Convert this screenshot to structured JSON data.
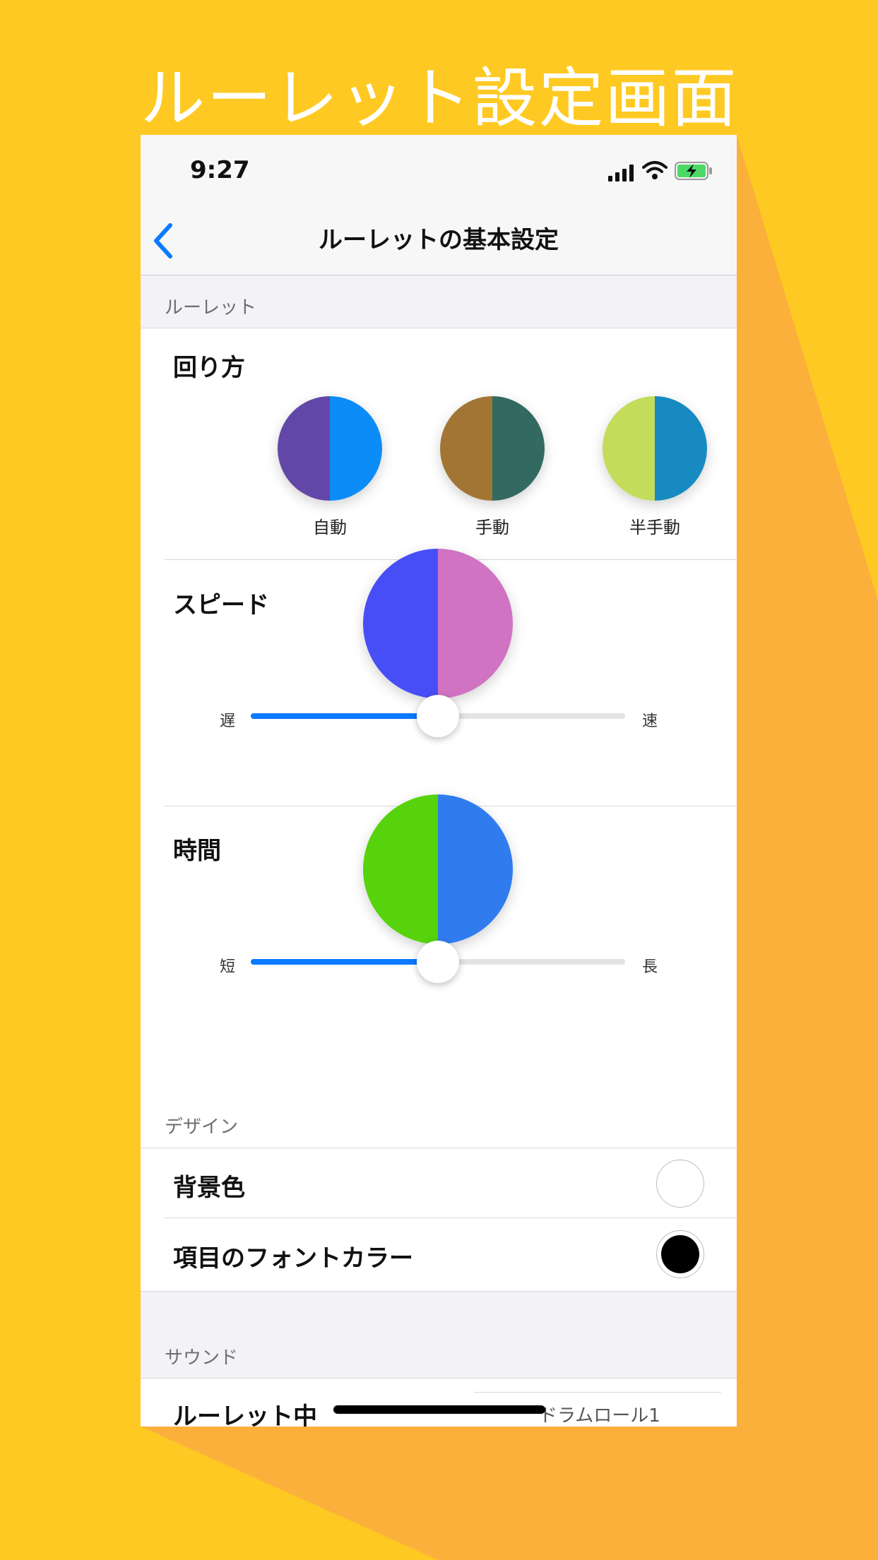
{
  "headline": "ルーレット設定画面",
  "status_bar": {
    "time": "9:27"
  },
  "nav": {
    "title": "ルーレットの基本設定"
  },
  "sections": {
    "roulette_header": "ルーレット",
    "design_header": "デザイン",
    "sound_header": "サウンド"
  },
  "rotation": {
    "label": "回り方",
    "options": [
      {
        "label": "自動",
        "colors": [
          "#6347A8",
          "#0C8CF6"
        ]
      },
      {
        "label": "手動",
        "colors": [
          "#A37534",
          "#326A62"
        ]
      },
      {
        "label": "半手動",
        "colors": [
          "#C3DC5A",
          "#178BC1"
        ]
      }
    ]
  },
  "speed": {
    "label": "スピード",
    "colors": [
      "#474EF6",
      "#D073C2"
    ],
    "min_label": "遅",
    "max_label": "速",
    "value_fraction": 0.5
  },
  "duration": {
    "label": "時間",
    "colors": [
      "#56D30D",
      "#307CEF"
    ],
    "min_label": "短",
    "max_label": "長",
    "value_fraction": 0.5
  },
  "design": {
    "background_color_label": "背景色",
    "background_color": "#FFFFFF",
    "font_color_label": "項目のフォントカラー",
    "font_color": "#000000"
  },
  "sound": {
    "during_label": "ルーレット中",
    "during_value": "ドラムロール1"
  },
  "colors": {
    "page_background": "#FEC922",
    "shadow": "#FBB03B",
    "accent": "#0A7AFF"
  }
}
